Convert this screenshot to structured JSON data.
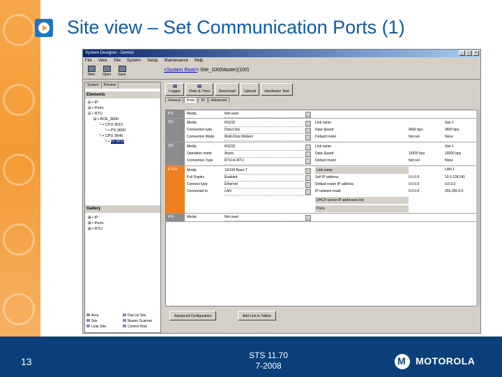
{
  "slide": {
    "title": "Site view – Set Communication Ports (1)",
    "page_number": "13",
    "footer_line1": "STS 11.70",
    "footer_line2": "7-2008",
    "brand": "MOTOROLA",
    "brand_mark": "M",
    "colors": {
      "title": "#0d5aa8",
      "footer": "#0a3f7a",
      "accent_orange": "#f39a33"
    }
  },
  "window": {
    "title": "System Designer - Demo1",
    "menu": [
      "File",
      "View",
      "Site",
      "System",
      "Setup",
      "Maintenance",
      "Help"
    ],
    "toolbar": [
      "New",
      "Open",
      "Save"
    ],
    "path_link": "<System Root>",
    "path_rest": "\\ Site_100(Master)(100)"
  },
  "left": {
    "tabs": [
      "System",
      "Preview"
    ],
    "elements_header": "Elements",
    "tree": [
      "IP",
      "Ports",
      "RTU",
      "ACE_3600",
      "CPU 3610",
      "PS 3600",
      "CPU 3640",
      "IO 3610"
    ],
    "gallery_header": "Gallery",
    "gallery": [
      "IP",
      "Ports",
      "RTU"
    ],
    "legend": [
      "Area",
      "Dial Up Site",
      "Site",
      "Master Scanner",
      "Leak Site",
      "Control Host"
    ]
  },
  "right": {
    "buttons": [
      "Logger",
      "Date & Time",
      "Download",
      "Upload",
      "Hardware Test"
    ],
    "tabs": [
      "General",
      "Ports",
      "IO",
      "Advanced"
    ],
    "ports": [
      {
        "name": "PI1",
        "fields": [
          [
            "Media",
            "Not used"
          ]
        ]
      },
      {
        "name": "SI1",
        "fields": [
          [
            "Media",
            "RS232"
          ],
          [
            "Connection type",
            "Direct link"
          ],
          [
            "Connection Mode",
            "Multi-Drop Modem"
          ]
        ],
        "right": [
          [
            "Link name",
            "",
            "Site 1"
          ],
          [
            "Data Speed",
            "9600 bps",
            "9600 bps"
          ],
          [
            "Default router",
            "Not set",
            "None"
          ]
        ]
      },
      {
        "name": "SI2",
        "fields": [
          [
            "Media",
            "RS232"
          ],
          [
            "Operation mode",
            "Async"
          ],
          [
            "Connection Type",
            "RTU-to-RTU"
          ]
        ],
        "right": [
          [
            "Link name",
            "",
            "Site 1"
          ],
          [
            "Data Speed",
            "19200 bps",
            "19200 bps"
          ],
          [
            "Default router",
            "Not set",
            "None"
          ]
        ]
      },
      {
        "name": "ETH1",
        "fields": [
          [
            "Media",
            "10/100 Base-T"
          ],
          [
            "Full Duplex",
            "Enabled"
          ],
          [
            "Connect type",
            "Ethernet"
          ],
          [
            "Connected to",
            "LAN"
          ]
        ],
        "right": [
          [
            "Link name",
            "",
            "LAN 1"
          ],
          [
            "Self IP address",
            "0.0.0.0",
            "10.5.128.241"
          ],
          [
            "Default router IP address",
            "0.0.0.0",
            "0.0.0.0"
          ],
          [
            "IP network mask",
            "0.0.0.0",
            "255.255.0.0"
          ],
          [
            "DHCP server IP addresses list",
            "",
            ""
          ],
          [
            "Ports",
            "",
            ""
          ]
        ]
      },
      {
        "name": "PI2",
        "fields": [
          [
            "Media",
            "Not used"
          ]
        ]
      }
    ],
    "bottom_buttons": [
      "Advanced Configuration",
      "Add Link to Tables"
    ]
  }
}
